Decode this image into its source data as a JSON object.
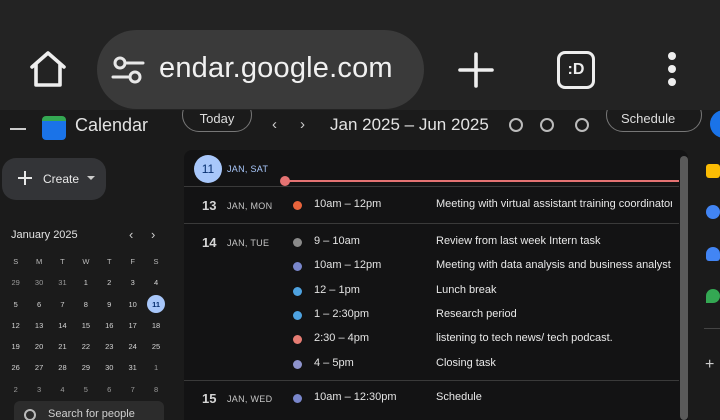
{
  "browser": {
    "url": "endar.google.com",
    "tab_switcher_label": ":D",
    "icons": [
      "home-icon",
      "tune-icon",
      "plus-icon",
      "tab-switcher-icon",
      "more-vert-icon"
    ]
  },
  "header": {
    "title": "Calendar",
    "today_label": "Today",
    "date_range": "Jan 2025 – Jun 2025",
    "view_label": "Schedule"
  },
  "sidebar": {
    "create_label": "Create",
    "mini_calendar": {
      "title": "January 2025",
      "weekdays": [
        "S",
        "M",
        "T",
        "W",
        "T",
        "F",
        "S"
      ],
      "weeks": [
        [
          "29",
          "30",
          "31",
          "1",
          "2",
          "3",
          "4"
        ],
        [
          "5",
          "6",
          "7",
          "8",
          "9",
          "10",
          "11"
        ],
        [
          "12",
          "13",
          "14",
          "15",
          "16",
          "17",
          "18"
        ],
        [
          "19",
          "20",
          "21",
          "22",
          "23",
          "24",
          "25"
        ],
        [
          "26",
          "27",
          "28",
          "29",
          "30",
          "31",
          "1"
        ],
        [
          "2",
          "3",
          "4",
          "5",
          "6",
          "7",
          "8"
        ]
      ],
      "selected": "11"
    },
    "people_search_placeholder": "Search for people"
  },
  "schedule": {
    "today": {
      "num": "11",
      "label": "JAN, SAT"
    },
    "days": [
      {
        "num": "13",
        "label": "JAN, MON",
        "events": [
          {
            "time": "10am – 12pm",
            "title": "Meeting with virtual assistant training coordinator",
            "color": "#e8643c"
          }
        ]
      },
      {
        "num": "14",
        "label": "JAN, TUE",
        "events": [
          {
            "time": "9 – 10am",
            "title": "Review from last week Intern task",
            "color": "#8a8a8a"
          },
          {
            "time": "10am – 12pm",
            "title": "Meeting with data analysis and business analyst",
            "color": "#7986cb"
          },
          {
            "time": "12 – 1pm",
            "title": "Lunch break",
            "color": "#4ea2e0"
          },
          {
            "time": "1 – 2:30pm",
            "title": "Research period",
            "color": "#4ea2e0"
          },
          {
            "time": "2:30 – 4pm",
            "title": "listening to tech news/ tech podcast.",
            "color": "#e67c73"
          },
          {
            "time": "4 – 5pm",
            "title": "Closing task",
            "color": "#8e93cc"
          }
        ]
      },
      {
        "num": "15",
        "label": "JAN, WED",
        "events": [
          {
            "time": "10am – 12:30pm",
            "title": "Schedule",
            "color": "#7986cb"
          }
        ]
      }
    ]
  },
  "side_panel": {
    "colors": {
      "keep": "#fbbc04",
      "tasks": "#4285f4",
      "contacts": "#4285f4",
      "maps": "#34a853"
    }
  }
}
